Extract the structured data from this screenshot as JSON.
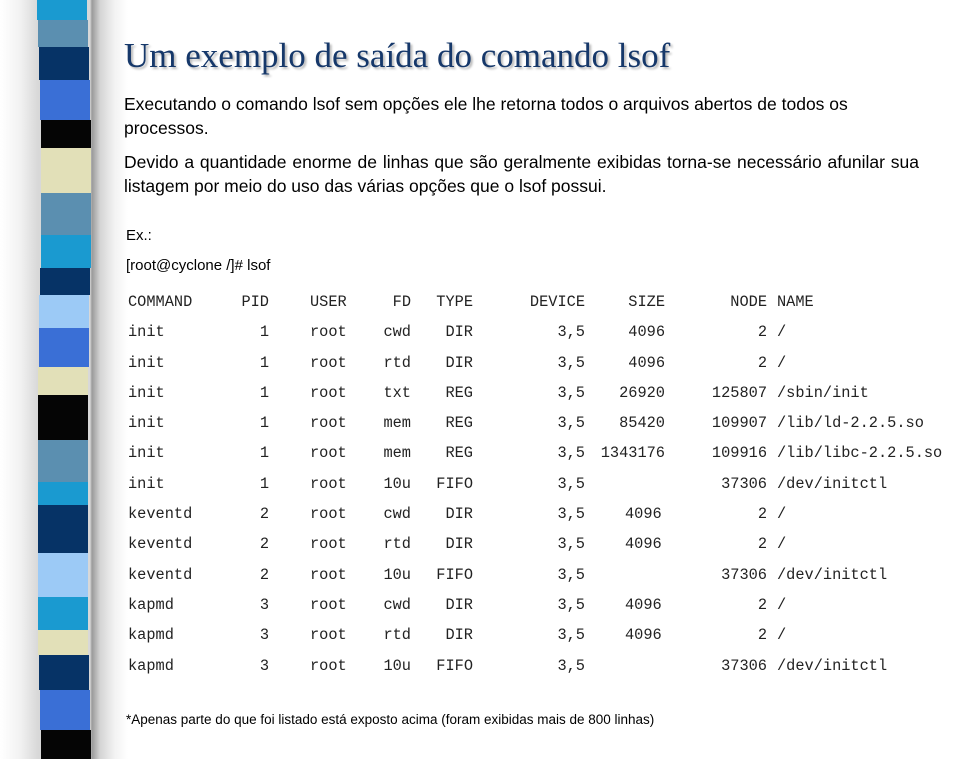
{
  "slide": {
    "title": "Um exemplo de saída do comando lsof",
    "paragraph1": "Executando o comando lsof sem opções ele lhe retorna todos o arquivos abertos de todos os processos.",
    "paragraph2": "Devido a quantidade enorme de linhas que são geralmente exibidas torna-se necessário afunilar sua listagem por meio do uso das várias opções que o lsof possui.",
    "example_label": "Ex.:",
    "prompt": "[root@cyclone /]# lsof",
    "footnote": "*Apenas parte do que foi listado está exposto acima (foram exibidas mais de 800 linhas)"
  },
  "decoration": {
    "stripe_colors": {
      "cyan": "#1a9ad0",
      "steel": "#5b8fb0",
      "navy": "#063366",
      "royal": "#3a6fd6",
      "black": "#050505",
      "beige": "#e2e0b8",
      "light": "#9ccaf6"
    },
    "stripes": [
      "cyan",
      "steel",
      "navy",
      "royal",
      "black",
      "beige",
      "steel",
      "cyan",
      "navy",
      "light",
      "royal",
      "beige",
      "black",
      "steel",
      "cyan",
      "navy",
      "light",
      "cyan",
      "beige",
      "navy",
      "royal",
      "black"
    ]
  },
  "lsof_output": {
    "headers": {
      "command": "COMMAND",
      "pid": "PID",
      "user": "USER",
      "fd": "FD",
      "type": "TYPE",
      "device": "DEVICE",
      "size": "SIZE",
      "node": "NODE",
      "name": "NAME"
    },
    "rows": [
      {
        "command": "init",
        "pid": "1",
        "user": "root",
        "fd": "cwd",
        "type": "DIR",
        "device": "3,5",
        "size": "4096",
        "node": "2",
        "name": "/"
      },
      {
        "command": "init",
        "pid": "1",
        "user": "root",
        "fd": "rtd",
        "type": "DIR",
        "device": "3,5",
        "size": "4096",
        "node": "2",
        "name": "/"
      },
      {
        "command": "init",
        "pid": "1",
        "user": "root",
        "fd": "txt",
        "type": "REG",
        "device": "3,5",
        "size": "26920",
        "node": "125807",
        "name": "/sbin/init"
      },
      {
        "command": "init",
        "pid": "1",
        "user": "root",
        "fd": "mem",
        "type": "REG",
        "device": "3,5",
        "size": "85420",
        "node": "109907",
        "name": "/lib/ld-2.2.5.so"
      },
      {
        "command": "init",
        "pid": "1",
        "user": "root",
        "fd": "mem",
        "type": "REG",
        "device": "3,5",
        "size": "1343176",
        "node": "109916",
        "name": "/lib/libc-2.2.5.so"
      },
      {
        "command": "init",
        "pid": "1",
        "user": "root",
        "fd": "10u",
        "type": "FIFO",
        "device": "3,5",
        "size": "",
        "node": "37306",
        "name": "/dev/initctl"
      },
      {
        "command": "keventd",
        "pid": "2",
        "user": "root",
        "fd": "cwd",
        "type": "DIR",
        "device": "3,5",
        "size": "4096",
        "node": "2",
        "name": "/"
      },
      {
        "command": "keventd",
        "pid": "2",
        "user": "root",
        "fd": "rtd",
        "type": "DIR",
        "device": "3,5",
        "size": "4096",
        "node": "2",
        "name": "/"
      },
      {
        "command": "keventd",
        "pid": "2",
        "user": "root",
        "fd": "10u",
        "type": "FIFO",
        "device": "3,5",
        "size": "",
        "node": "37306",
        "name": "/dev/initctl"
      },
      {
        "command": "kapmd",
        "pid": "3",
        "user": "root",
        "fd": "cwd",
        "type": "DIR",
        "device": "3,5",
        "size": "4096",
        "node": "2",
        "name": "/"
      },
      {
        "command": "kapmd",
        "pid": "3",
        "user": "root",
        "fd": "rtd",
        "type": "DIR",
        "device": "3,5",
        "size": "4096",
        "node": "2",
        "name": "/"
      },
      {
        "command": "kapmd",
        "pid": "3",
        "user": "root",
        "fd": "10u",
        "type": "FIFO",
        "device": "3,5",
        "size": "",
        "node": "37306",
        "name": "/dev/initctl"
      }
    ]
  }
}
